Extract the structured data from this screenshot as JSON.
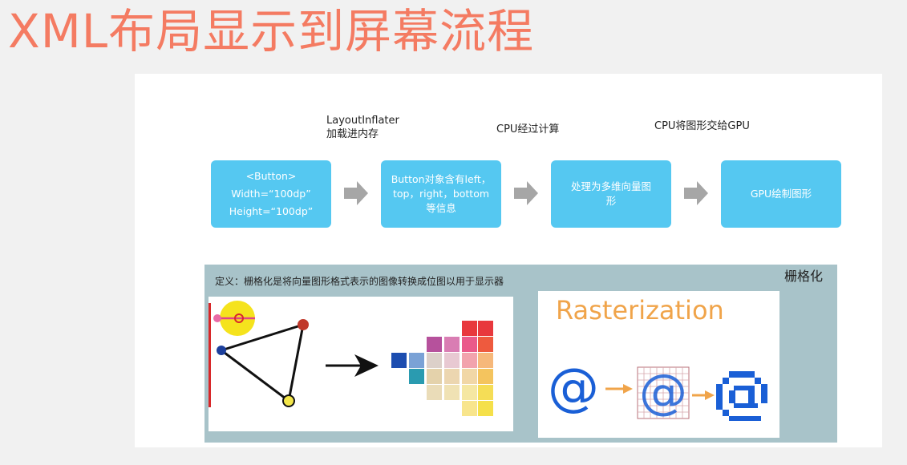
{
  "title": "XML布局显示到屏幕流程",
  "captions": {
    "inflater_line1": "LayoutInflater",
    "inflater_line2": "加载进内存",
    "cpu_calc": "CPU经过计算",
    "cpu_to_gpu": "CPU将图形交给GPU"
  },
  "steps": [
    {
      "lines": [
        "<Button>",
        "Width=“100dp”",
        "Height=“100dp”"
      ]
    },
    {
      "lines": [
        "Button对象含有left，",
        "top，right，bottom",
        "等信息"
      ]
    },
    {
      "lines": [
        "处理为多维向量图",
        "形"
      ]
    },
    {
      "lines": [
        "GPU绘制图形"
      ]
    }
  ],
  "rasterization": {
    "definition": "定义：栅格化是将向量图形格式表示的图像转换成位图以用于显示器",
    "tag": "栅格化",
    "word": "Rasterization",
    "glyph": "@"
  },
  "colors": {
    "title": "#f47b62",
    "step_box": "#55c8f1",
    "arrow": "#a6a6a6",
    "raster_bg": "#a8c3c9",
    "rasterization_word": "#f0a44a",
    "at_blue": "#1a5fd6"
  }
}
